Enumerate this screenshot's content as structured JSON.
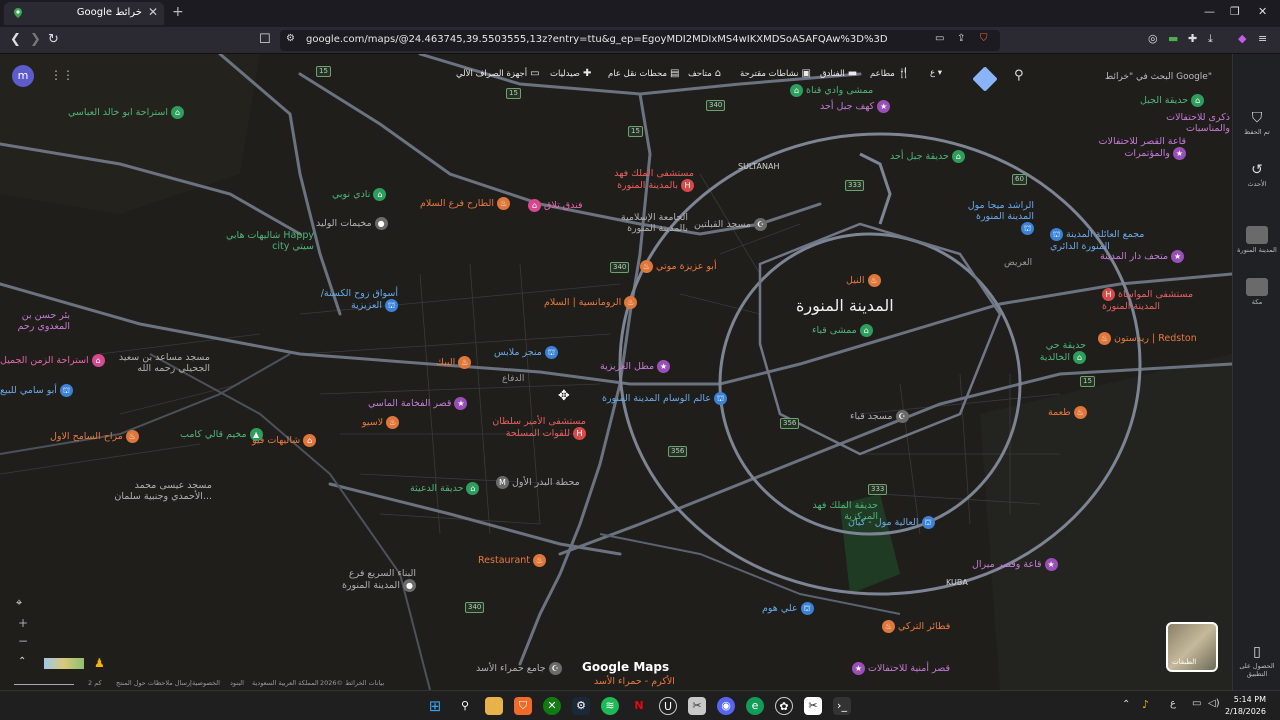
{
  "browser": {
    "tab_title": "Google خرائط",
    "url": "google.com/maps/@24.463745,39.5503555,13z?entry=ttu&g_ep=EgoyMDI2MDIxMS4wIKXMDSoASAFQAw%3D%3D"
  },
  "maps": {
    "avatar_letter": "m",
    "search_placeholder": "البحث في \"خرائط Google\"",
    "chips": [
      {
        "label": "مطاعم",
        "icon": "restaurant-icon"
      },
      {
        "label": "الفنادق",
        "icon": "hotel-icon"
      },
      {
        "label": "نشاطات مقترحة",
        "icon": "camera-icon"
      },
      {
        "label": "متاحف",
        "icon": "museum-icon"
      },
      {
        "label": "محطات نقل عام",
        "icon": "transit-icon"
      },
      {
        "label": "صيدليات",
        "icon": "pharmacy-icon"
      },
      {
        "label": "أجهزة الصراف الآلي",
        "icon": "atm-icon"
      }
    ],
    "city_label": "المدينة المنورة",
    "districts": [
      "SULTANAH",
      "KUBA",
      "العريض",
      "الدفاع"
    ],
    "places": [
      {
        "name": "استراحة ابو خالد العباسي",
        "color": "green"
      },
      {
        "name": "نادي نوبي",
        "color": "green"
      },
      {
        "name": "مخيمات الوليد",
        "color": "gray"
      },
      {
        "name": "الطارح فرع السلام",
        "color": "orange"
      },
      {
        "name": "فندق تلاق",
        "color": "pink"
      },
      {
        "name": "شاليهات هابي Happy city سيتي",
        "color": "green"
      },
      {
        "name": "أسواق زوح الكسنة/ العزيزية",
        "color": "blue"
      },
      {
        "name": "بئر حسن بن المغدوي رحم",
        "color": "purple"
      },
      {
        "name": "استراحة الزمن الجميل",
        "color": "pink"
      },
      {
        "name": "أبو سامي للبيع",
        "color": "blue"
      },
      {
        "name": "مسجد مساعد بن سعيد الجحيلي رحمه الله",
        "color": "gray"
      },
      {
        "name": "مراح السامح الاول",
        "color": "orange"
      },
      {
        "name": "مخيم قالي كامب",
        "color": "green"
      },
      {
        "name": "شاليهات فيو",
        "color": "orange"
      },
      {
        "name": "لاسيو",
        "color": "orange"
      },
      {
        "name": "قصر الفخامة الماسي",
        "color": "purple"
      },
      {
        "name": "البيك",
        "color": "orange"
      },
      {
        "name": "منجر ملابس",
        "color": "blue"
      },
      {
        "name": "الرومانسية | السلام",
        "color": "orange"
      },
      {
        "name": "مطل العزيزية",
        "color": "purple"
      },
      {
        "name": "مستشفى الأمير سلطان للقوات المسلحة",
        "color": "red"
      },
      {
        "name": "عالم الوسام المدينة المنورة",
        "color": "blue"
      },
      {
        "name": "مسجد عيسى محمد الأحمدي وجنبية سلمان...",
        "color": "gray"
      },
      {
        "name": "حديقة الدعيثة",
        "color": "green"
      },
      {
        "name": "محطة البدر الأول",
        "color": "gray"
      },
      {
        "name": "Restaurant",
        "color": "orange"
      },
      {
        "name": "البناء السريع فرع المدينة المنورة",
        "color": "gray"
      },
      {
        "name": "مستشفى الملك فهد بالمدينة المنورة",
        "color": "red"
      },
      {
        "name": "الجامعة الإسلامية بالمدينة المنورة",
        "color": "gray"
      },
      {
        "name": "مسجد القبلتين",
        "color": "gray"
      },
      {
        "name": "أبو عزيزة موتي",
        "color": "orange"
      },
      {
        "name": "ممشى وادي قناة",
        "color": "green"
      },
      {
        "name": "كهف جبل أحد",
        "color": "purple"
      },
      {
        "name": "حديقة جبل أحد",
        "color": "green"
      },
      {
        "name": "النيل",
        "color": "orange"
      },
      {
        "name": "ممشى قباء",
        "color": "green"
      },
      {
        "name": "الراشد ميجا مول المدينة المنورة",
        "color": "blue"
      },
      {
        "name": "مجمع العائلة المدينة المنورة الدائري",
        "color": "blue"
      },
      {
        "name": "متحف دار المدينة",
        "color": "purple"
      },
      {
        "name": "حديقة الجبل",
        "color": "green"
      },
      {
        "name": "ذكرى للاحتفالات والمناسبات",
        "color": "purple"
      },
      {
        "name": "قاعة القصر للاحتفالات والمؤتمرات",
        "color": "purple"
      },
      {
        "name": "مستشفى المواساة المدينة المنورة",
        "color": "red"
      },
      {
        "name": "ريدستون | Redston",
        "color": "orange"
      },
      {
        "name": "حديقة حي الخالدية",
        "color": "green"
      },
      {
        "name": "طعمة",
        "color": "orange"
      },
      {
        "name": "مسجد قباء",
        "color": "gray"
      },
      {
        "name": "حديقة الملك فهد المركزية",
        "color": "green"
      },
      {
        "name": "العالية مول - كيان",
        "color": "blue"
      },
      {
        "name": "قاعة وقصر ميرال",
        "color": "purple"
      },
      {
        "name": "علي هوم",
        "color": "blue"
      },
      {
        "name": "فطائر التركي",
        "color": "orange"
      },
      {
        "name": "قصر أمنية للاحتفالات",
        "color": "purple"
      },
      {
        "name": "جامع حمراء الأسد",
        "color": "gray"
      },
      {
        "name": "الأكرم - حمراء الأسد",
        "color": "orange"
      }
    ],
    "road_shields": [
      "15",
      "340",
      "15",
      "340",
      "333",
      "356",
      "333",
      "356",
      "60",
      "340",
      "15",
      "15"
    ],
    "watermark": "Google Maps",
    "layers_label": "الطبقات",
    "scale_label": "2 كم",
    "footer_links": [
      "بيانات الخرائط ©2026",
      "المملكة العربية السعودية",
      "البنود",
      "الخصوصية",
      "إرسال ملاحظات حول المنتج"
    ]
  },
  "sidepanel": {
    "items": [
      {
        "label": "تم الحفظ",
        "icon": "bookmark-icon"
      },
      {
        "label": "الأحدث",
        "icon": "history-icon"
      },
      {
        "label": "المدينة المنورة",
        "icon": "recent-place-icon"
      },
      {
        "label": "مكة",
        "icon": "recent-place-icon"
      },
      {
        "label": "الحصول على التطبيق",
        "icon": "phone-icon"
      }
    ]
  },
  "taskbar": {
    "time": "5:14 PM",
    "date": "2/18/2026",
    "lang": "ع"
  }
}
